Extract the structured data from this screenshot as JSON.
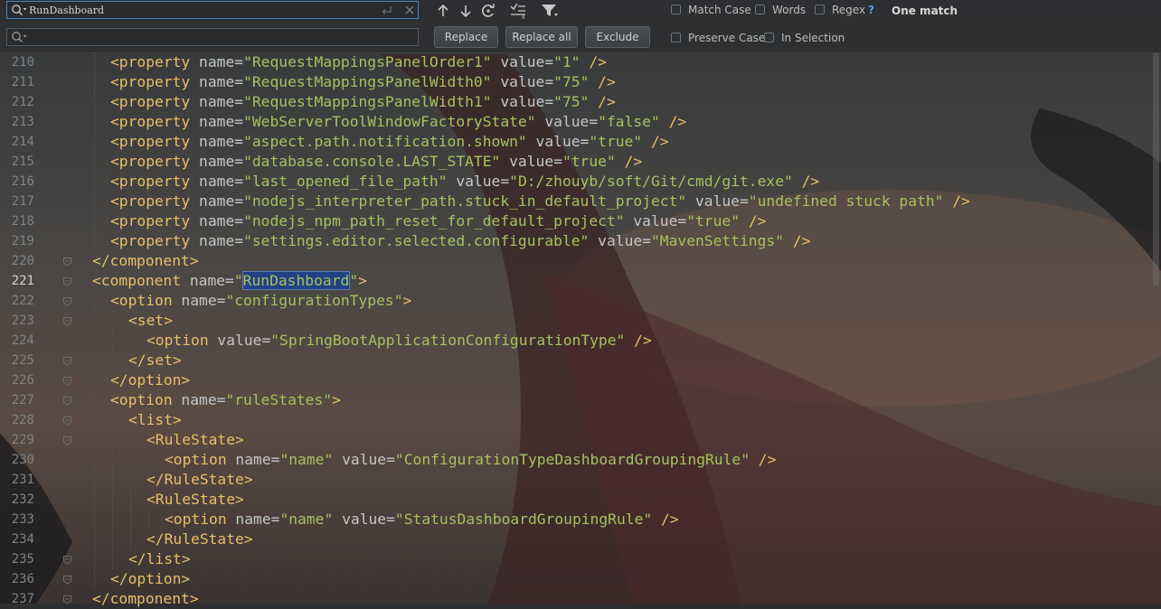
{
  "search": {
    "find_value": "RunDashboard",
    "replace_value": "",
    "match_count": "One match",
    "help": "?"
  },
  "options": {
    "match_case": "Match Case",
    "words": "Words",
    "regex": "Regex",
    "preserve_case": "Preserve Case",
    "in_selection": "In Selection"
  },
  "buttons": {
    "replace": "Replace",
    "replace_all": "Replace all",
    "exclude": "Exclude"
  },
  "editor": {
    "current_line": 221,
    "lines": [
      {
        "no": "210",
        "indent": 2,
        "tokens": [
          {
            "t": "tag",
            "v": "<property"
          },
          {
            "t": "attr",
            "v": " name="
          },
          {
            "t": "val",
            "v": "\"RequestMappingsPanelOrder1\""
          },
          {
            "t": "attr",
            "v": " value="
          },
          {
            "t": "val",
            "v": "\"1\""
          },
          {
            "t": "tag",
            "v": " />"
          }
        ]
      },
      {
        "no": "211",
        "indent": 2,
        "tokens": [
          {
            "t": "tag",
            "v": "<property"
          },
          {
            "t": "attr",
            "v": " name="
          },
          {
            "t": "val",
            "v": "\"RequestMappingsPanelWidth0\""
          },
          {
            "t": "attr",
            "v": " value="
          },
          {
            "t": "val",
            "v": "\"75\""
          },
          {
            "t": "tag",
            "v": " />"
          }
        ]
      },
      {
        "no": "212",
        "indent": 2,
        "tokens": [
          {
            "t": "tag",
            "v": "<property"
          },
          {
            "t": "attr",
            "v": " name="
          },
          {
            "t": "val",
            "v": "\"RequestMappingsPanelWidth1\""
          },
          {
            "t": "attr",
            "v": " value="
          },
          {
            "t": "val",
            "v": "\"75\""
          },
          {
            "t": "tag",
            "v": " />"
          }
        ]
      },
      {
        "no": "213",
        "indent": 2,
        "tokens": [
          {
            "t": "tag",
            "v": "<property"
          },
          {
            "t": "attr",
            "v": " name="
          },
          {
            "t": "val",
            "v": "\"WebServerToolWindowFactoryState\""
          },
          {
            "t": "attr",
            "v": " value="
          },
          {
            "t": "val",
            "v": "\"false\""
          },
          {
            "t": "tag",
            "v": " />"
          }
        ]
      },
      {
        "no": "214",
        "indent": 2,
        "tokens": [
          {
            "t": "tag",
            "v": "<property"
          },
          {
            "t": "attr",
            "v": " name="
          },
          {
            "t": "val",
            "v": "\"aspect.path.notification.shown\""
          },
          {
            "t": "attr",
            "v": " value="
          },
          {
            "t": "val",
            "v": "\"true\""
          },
          {
            "t": "tag",
            "v": " />"
          }
        ]
      },
      {
        "no": "215",
        "indent": 2,
        "tokens": [
          {
            "t": "tag",
            "v": "<property"
          },
          {
            "t": "attr",
            "v": " name="
          },
          {
            "t": "val",
            "v": "\"database.console.LAST_STATE\""
          },
          {
            "t": "attr",
            "v": " value="
          },
          {
            "t": "val",
            "v": "\"true\""
          },
          {
            "t": "tag",
            "v": " />"
          }
        ]
      },
      {
        "no": "216",
        "indent": 2,
        "tokens": [
          {
            "t": "tag",
            "v": "<property"
          },
          {
            "t": "attr",
            "v": " name="
          },
          {
            "t": "val",
            "v": "\"last_opened_file_path\""
          },
          {
            "t": "attr",
            "v": " value="
          },
          {
            "t": "val",
            "v": "\"D:/zhouyb/soft/Git/cmd/git.exe\""
          },
          {
            "t": "tag",
            "v": " />"
          }
        ]
      },
      {
        "no": "217",
        "indent": 2,
        "tokens": [
          {
            "t": "tag",
            "v": "<property"
          },
          {
            "t": "attr",
            "v": " name="
          },
          {
            "t": "val",
            "v": "\"nodejs_interpreter_path.stuck_in_default_project\""
          },
          {
            "t": "attr",
            "v": " value="
          },
          {
            "t": "val",
            "v": "\"undefined stuck path\""
          },
          {
            "t": "tag",
            "v": " />"
          }
        ]
      },
      {
        "no": "218",
        "indent": 2,
        "tokens": [
          {
            "t": "tag",
            "v": "<property"
          },
          {
            "t": "attr",
            "v": " name="
          },
          {
            "t": "val",
            "v": "\"nodejs_npm_path_reset_for_default_project\""
          },
          {
            "t": "attr",
            "v": " value="
          },
          {
            "t": "val",
            "v": "\"true\""
          },
          {
            "t": "tag",
            "v": " />"
          }
        ]
      },
      {
        "no": "219",
        "indent": 2,
        "tokens": [
          {
            "t": "tag",
            "v": "<property"
          },
          {
            "t": "attr",
            "v": " name="
          },
          {
            "t": "val",
            "v": "\"settings.editor.selected.configurable\""
          },
          {
            "t": "attr",
            "v": " value="
          },
          {
            "t": "val",
            "v": "\"MavenSettings\""
          },
          {
            "t": "tag",
            "v": " />"
          }
        ]
      },
      {
        "no": "220",
        "indent": 1,
        "tokens": [
          {
            "t": "tag",
            "v": "</component>"
          }
        ]
      },
      {
        "no": "221",
        "indent": 1,
        "tokens": [
          {
            "t": "tag",
            "v": "<component"
          },
          {
            "t": "attr",
            "v": " name="
          },
          {
            "t": "val",
            "v": "\""
          },
          {
            "t": "hit",
            "v": "RunDashboard"
          },
          {
            "t": "val",
            "v": "\""
          },
          {
            "t": "tag",
            "v": ">"
          }
        ]
      },
      {
        "no": "222",
        "indent": 2,
        "tokens": [
          {
            "t": "tag",
            "v": "<option"
          },
          {
            "t": "attr",
            "v": " name="
          },
          {
            "t": "val",
            "v": "\"configurationTypes\""
          },
          {
            "t": "tag",
            "v": ">"
          }
        ]
      },
      {
        "no": "223",
        "indent": 3,
        "tokens": [
          {
            "t": "tag",
            "v": "<set>"
          }
        ]
      },
      {
        "no": "224",
        "indent": 4,
        "tokens": [
          {
            "t": "tag",
            "v": "<option"
          },
          {
            "t": "attr",
            "v": " value="
          },
          {
            "t": "val",
            "v": "\"SpringBootApplicationConfigurationType\""
          },
          {
            "t": "tag",
            "v": " />"
          }
        ]
      },
      {
        "no": "225",
        "indent": 3,
        "tokens": [
          {
            "t": "tag",
            "v": "</set>"
          }
        ]
      },
      {
        "no": "226",
        "indent": 2,
        "tokens": [
          {
            "t": "tag",
            "v": "</option>"
          }
        ]
      },
      {
        "no": "227",
        "indent": 2,
        "tokens": [
          {
            "t": "tag",
            "v": "<option"
          },
          {
            "t": "attr",
            "v": " name="
          },
          {
            "t": "val",
            "v": "\"ruleStates\""
          },
          {
            "t": "tag",
            "v": ">"
          }
        ]
      },
      {
        "no": "228",
        "indent": 3,
        "tokens": [
          {
            "t": "tag",
            "v": "<list>"
          }
        ]
      },
      {
        "no": "229",
        "indent": 4,
        "tokens": [
          {
            "t": "tag",
            "v": "<RuleState>"
          }
        ]
      },
      {
        "no": "230",
        "indent": 5,
        "tokens": [
          {
            "t": "tag",
            "v": "<option"
          },
          {
            "t": "attr",
            "v": " name="
          },
          {
            "t": "val",
            "v": "\"name\""
          },
          {
            "t": "attr",
            "v": " value="
          },
          {
            "t": "val",
            "v": "\"ConfigurationTypeDashboardGroupingRule\""
          },
          {
            "t": "tag",
            "v": " />"
          }
        ]
      },
      {
        "no": "231",
        "indent": 4,
        "tokens": [
          {
            "t": "tag",
            "v": "</RuleState>"
          }
        ]
      },
      {
        "no": "232",
        "indent": 4,
        "tokens": [
          {
            "t": "tag",
            "v": "<RuleState>"
          }
        ]
      },
      {
        "no": "233",
        "indent": 5,
        "tokens": [
          {
            "t": "tag",
            "v": "<option"
          },
          {
            "t": "attr",
            "v": " name="
          },
          {
            "t": "val",
            "v": "\"name\""
          },
          {
            "t": "attr",
            "v": " value="
          },
          {
            "t": "val",
            "v": "\"StatusDashboardGroupingRule\""
          },
          {
            "t": "tag",
            "v": " />"
          }
        ]
      },
      {
        "no": "234",
        "indent": 4,
        "tokens": [
          {
            "t": "tag",
            "v": "</RuleState>"
          }
        ]
      },
      {
        "no": "235",
        "indent": 3,
        "tokens": [
          {
            "t": "tag",
            "v": "</list>"
          }
        ]
      },
      {
        "no": "236",
        "indent": 2,
        "tokens": [
          {
            "t": "tag",
            "v": "</option>"
          }
        ]
      },
      {
        "no": "237",
        "indent": 1,
        "tokens": [
          {
            "t": "tag",
            "v": "</component>"
          }
        ]
      }
    ]
  }
}
